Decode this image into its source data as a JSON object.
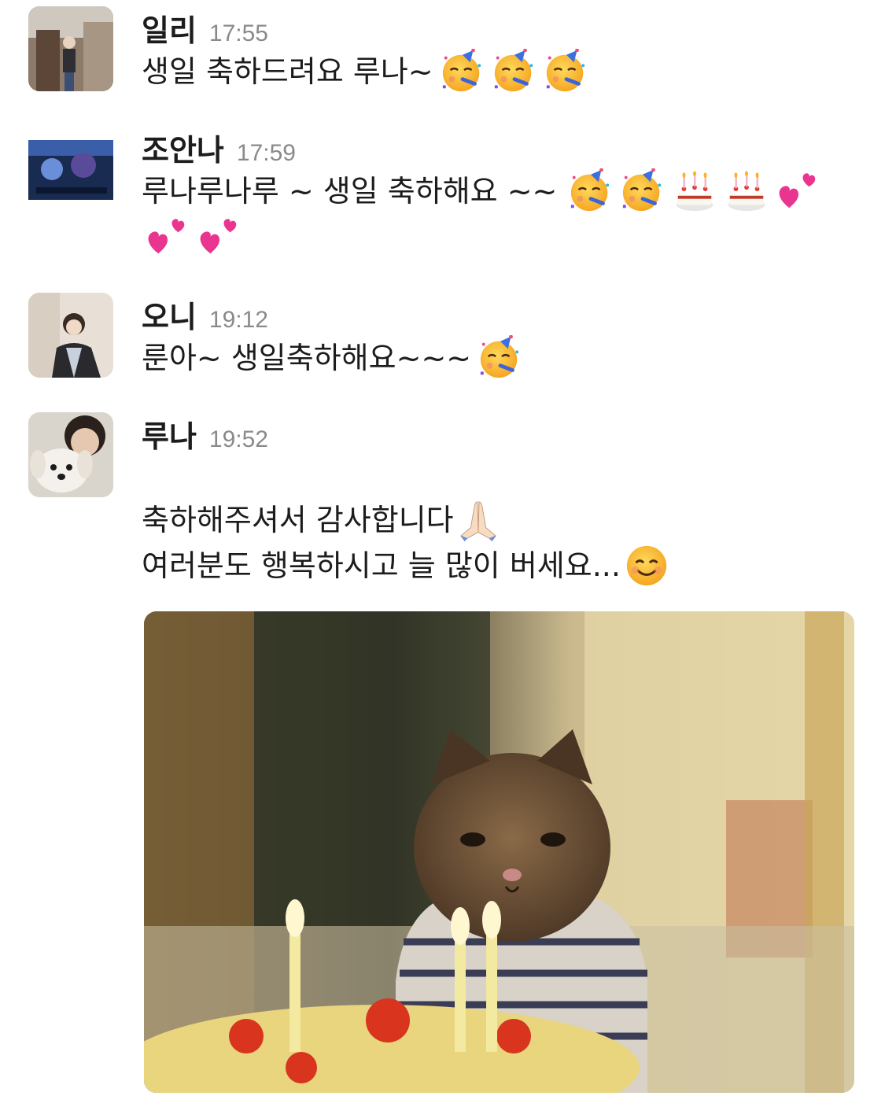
{
  "messages": [
    {
      "name": "일리",
      "time": "17:55",
      "text": "생일 축하드려요 루나~",
      "emojis": [
        "partying-face",
        "partying-face",
        "partying-face"
      ]
    },
    {
      "name": "조안나",
      "time": "17:59",
      "text": "루나루나루 ~ 생일 축하해요 ~~",
      "emojis_line1": [
        "partying-face",
        "partying-face",
        "birthday-cake",
        "birthday-cake",
        "two-hearts"
      ],
      "emojis_line2": [
        "two-hearts",
        "two-hearts"
      ]
    },
    {
      "name": "오니",
      "time": "19:12",
      "text": "룬아~ 생일축하해요~~~",
      "emojis": [
        "partying-face"
      ]
    },
    {
      "name": "루나",
      "time": "19:52",
      "line1": "축하해주셔서 감사합니다",
      "line1_emoji": "folded-hands",
      "line2": "여러분도 행복하시고 늘 많이 버세요...",
      "line2_emoji": "smiling-face",
      "attachment": "sad-cat-birthday-photo"
    }
  ],
  "colors": {
    "name": "#1d1c1d",
    "timestamp": "#8a8a8a",
    "background": "#ffffff"
  }
}
